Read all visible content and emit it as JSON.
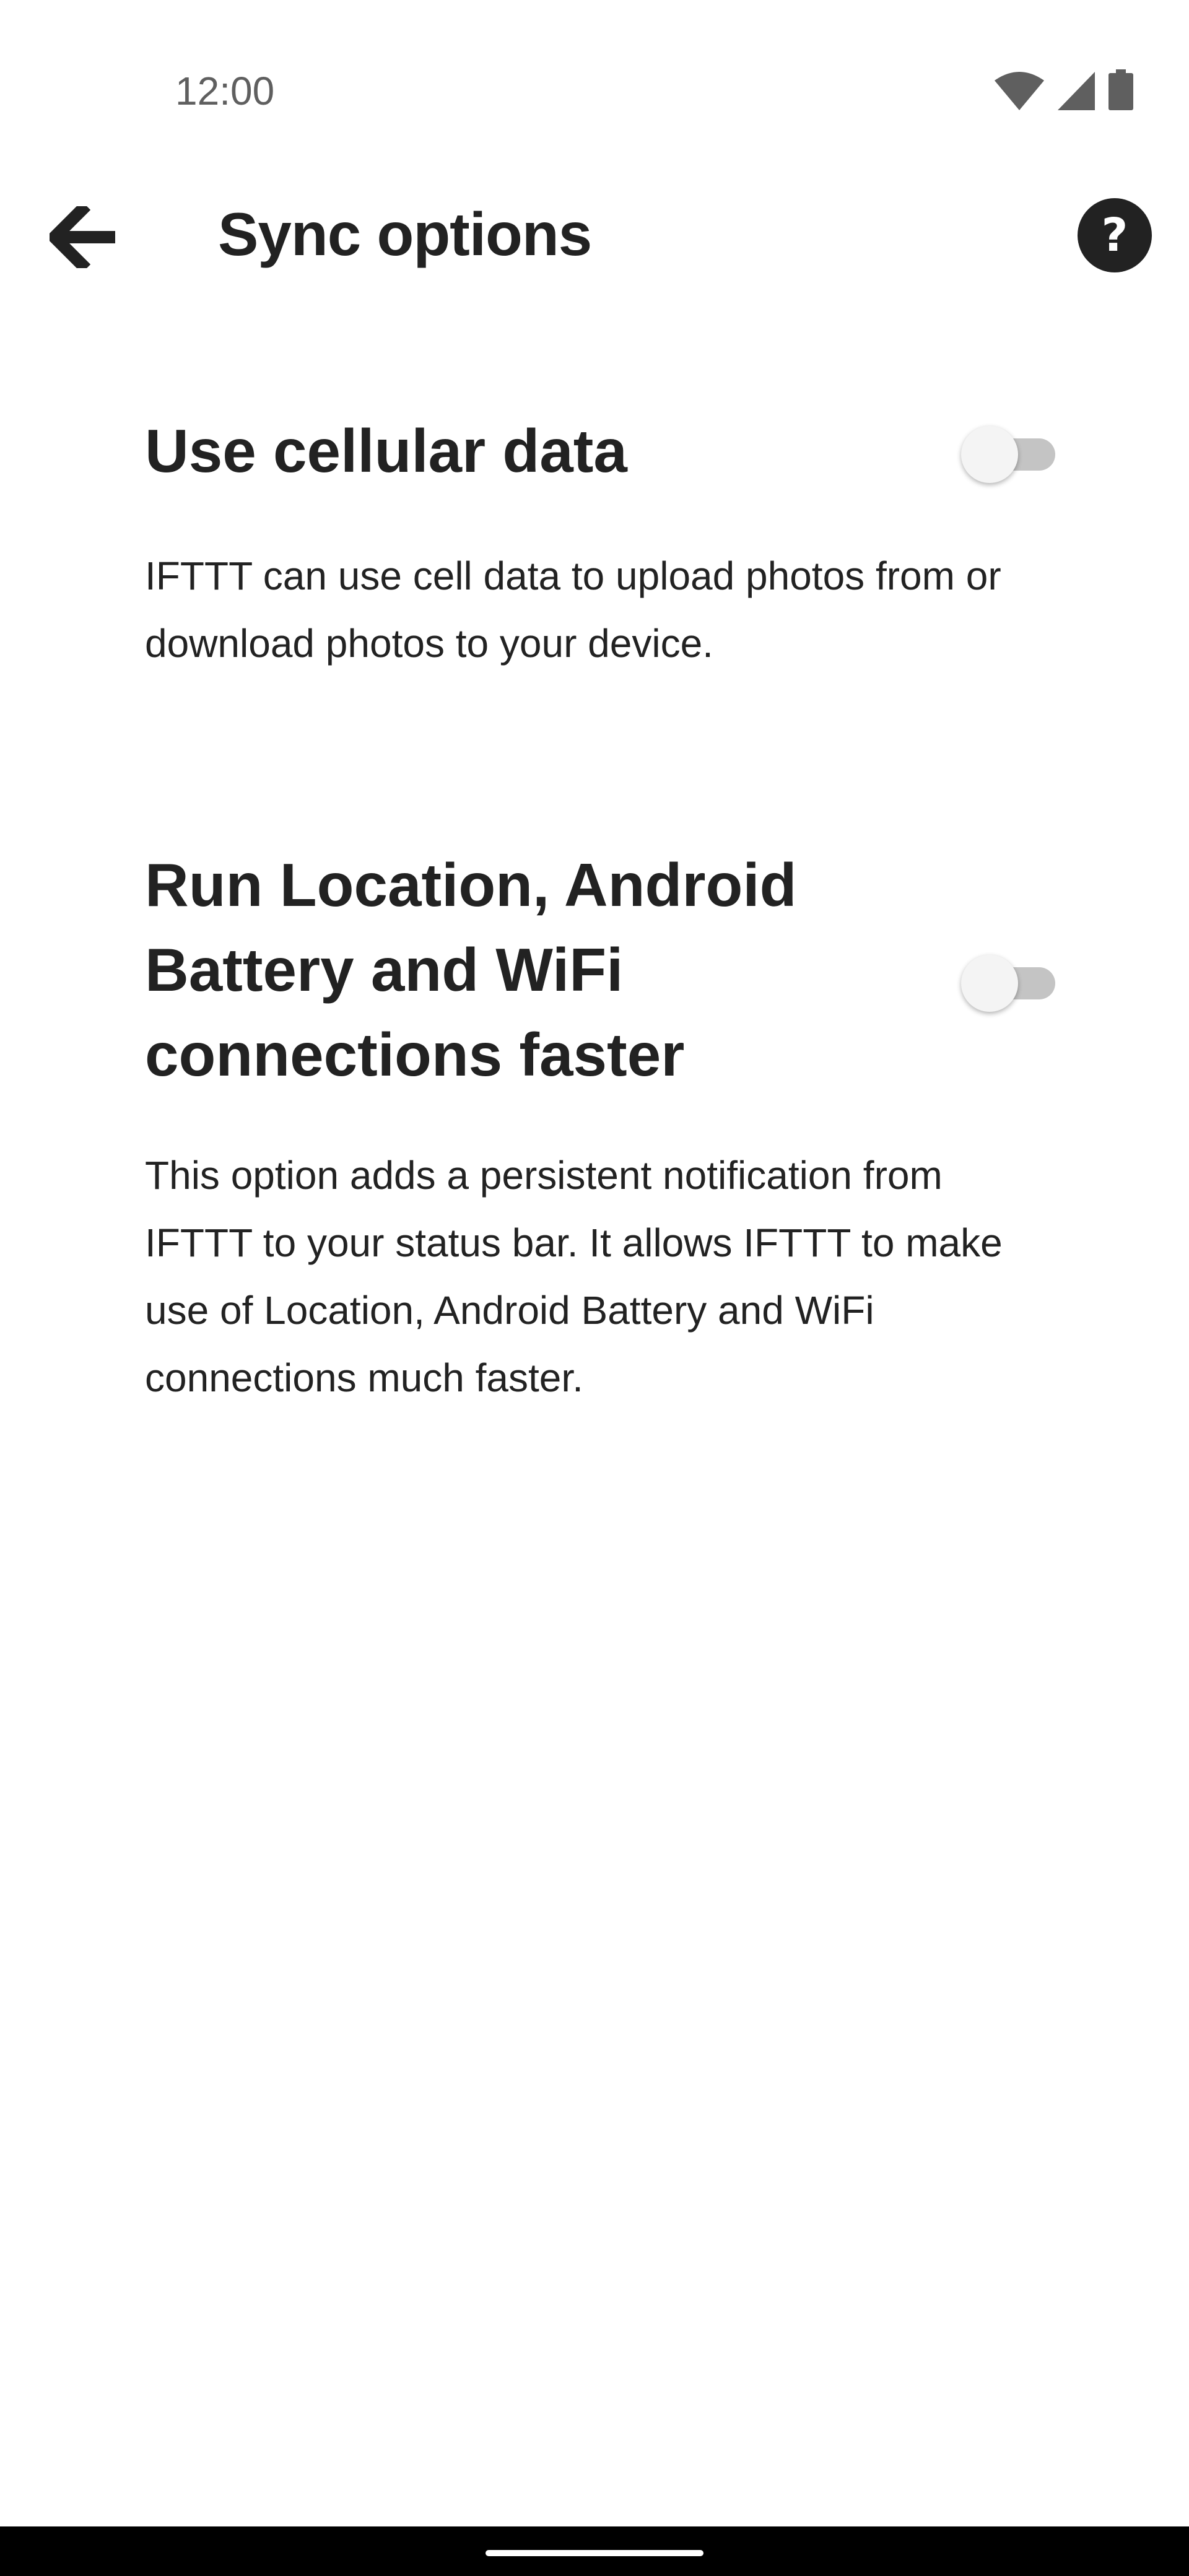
{
  "status_bar": {
    "time": "12:00",
    "icons": [
      "wifi-icon",
      "cellular-signal-icon",
      "battery-icon"
    ]
  },
  "app_bar": {
    "title": "Sync options",
    "back_icon": "arrow-back-icon",
    "help_icon": "help-icon",
    "help_glyph": "?"
  },
  "settings": [
    {
      "title": "Use cellular data",
      "description": "IFTTT can use cell data to upload photos from or download photos to your device.",
      "enabled": false
    },
    {
      "title": "Run Location, Android Battery and WiFi connections faster",
      "description": "This option adds a persistent notification from IFTTT to your status bar. It allows IFTTT to make use of Location, Android Battery and WiFi connections much faster.",
      "enabled": false
    }
  ],
  "colors": {
    "text": "#222222",
    "background": "#ffffff",
    "toggle_track_off": "#c4c4c4",
    "toggle_thumb_off": "#f4f4f4",
    "nav_bar": "#000000"
  }
}
